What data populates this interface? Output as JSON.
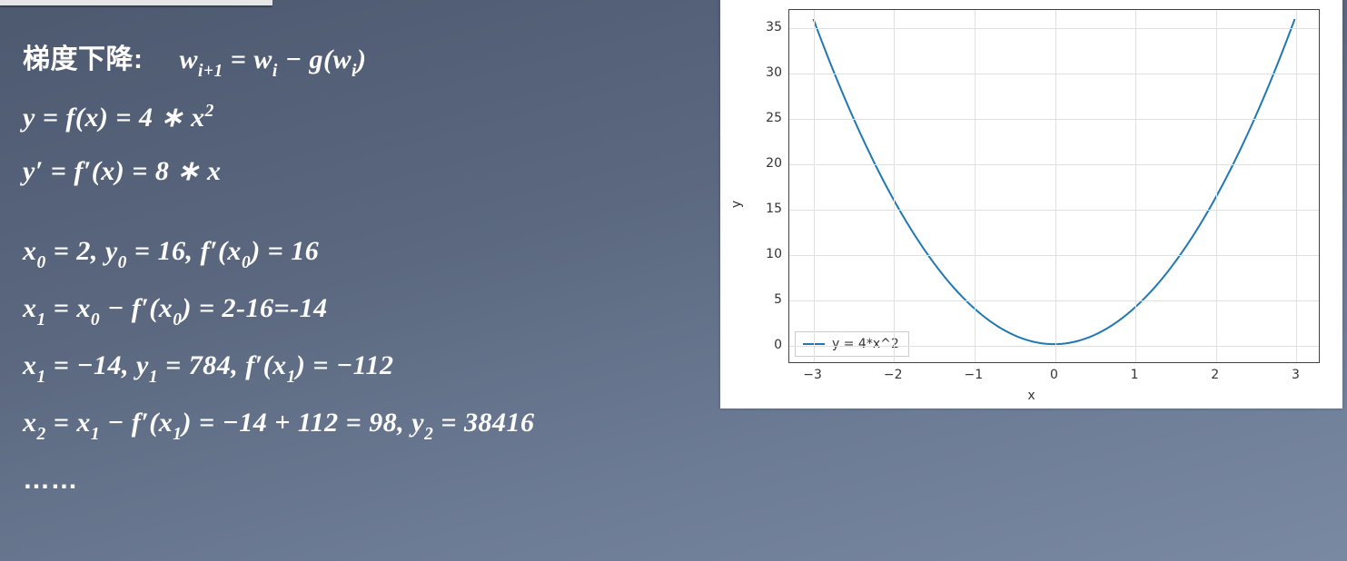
{
  "slide": {
    "title_prefix": "梯度下降:",
    "lines": {
      "l1_label": "梯度下降:",
      "l2": "y = f(x) = 4 ∗ x",
      "l2_sup": "2",
      "l3": "y′ = f′(x) = 8 ∗ x",
      "l4_a": "x",
      "l4_a_sub": "0",
      "l4_b": " = 2,   y",
      "l4_b_sub": "0",
      "l4_c": " = 16,  f′(x",
      "l4_c_sub": "0",
      "l4_d": ") = 16",
      "l5_a": "x",
      "l5_a_sub": "1",
      "l5_b": " = x",
      "l5_b_sub": "0",
      "l5_c": " − f′(x",
      "l5_c_sub": "0",
      "l5_d": ") = 2-16=-14",
      "l6_a": "x",
      "l6_a_sub": "1",
      "l6_b": " = −14,   y",
      "l6_b_sub": "1",
      "l6_c": " = 784,  f′(x",
      "l6_c_sub": "1",
      "l6_d": ") = −112",
      "l7_a": "x",
      "l7_a_sub": "2",
      "l7_b": " = x",
      "l7_b_sub": "1",
      "l7_c": " − f′(x",
      "l7_c_sub": "1",
      "l7_d": ") = −14 + 112 = 98,   y",
      "l7_d_sub": "2",
      "l7_e": " = 38416",
      "l8": "……"
    },
    "eq_update": {
      "lhs_var": "w",
      "lhs_sub": "i+1",
      "eq": " = ",
      "rhs1_var": "w",
      "rhs1_sub": "i",
      "minus": "  −  ",
      "g": "g(w",
      "g_sub": "i",
      "g_close": ")"
    }
  },
  "chart_data": {
    "type": "line",
    "title": "",
    "xlabel": "x",
    "ylabel": "y",
    "xlim": [
      -3.3,
      3.3
    ],
    "ylim": [
      -2,
      37
    ],
    "xticks": [
      -3,
      -2,
      -1,
      0,
      1,
      2,
      3
    ],
    "yticks": [
      0,
      5,
      10,
      15,
      20,
      25,
      30,
      35
    ],
    "legend": {
      "position": "lower-left",
      "entries": [
        "y = 4*x^2"
      ]
    },
    "series": [
      {
        "name": "y = 4*x^2",
        "color": "#1f77b4",
        "x": [
          -3.0,
          -2.5,
          -2.0,
          -1.5,
          -1.0,
          -0.5,
          0.0,
          0.5,
          1.0,
          1.5,
          2.0,
          2.5,
          3.0
        ],
        "y": [
          36.0,
          25.0,
          16.0,
          9.0,
          4.0,
          1.0,
          0.0,
          1.0,
          4.0,
          9.0,
          16.0,
          25.0,
          36.0
        ]
      }
    ]
  }
}
